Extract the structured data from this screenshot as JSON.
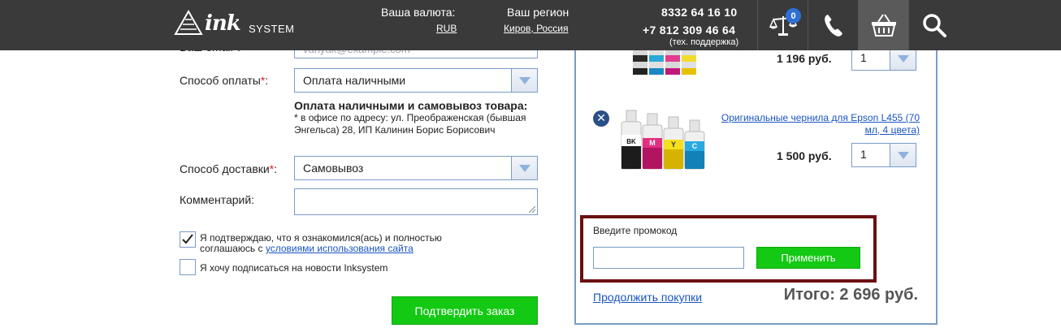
{
  "header": {
    "logo_text_ink": "ink",
    "logo_text_system": "SYSTEM",
    "currency_label": "Ваша валюта:",
    "currency_value": "RUB",
    "region_label": "Ваш регион",
    "region_value": "Киров, Россия",
    "phone_1": "8332 64 16 10",
    "phone_2": "+7 812 309 46 64",
    "phone_note": "(тех. поддержка)",
    "compare_count": "0",
    "icons": [
      "scales-icon",
      "phone-icon",
      "basket-icon",
      "search-icon"
    ]
  },
  "form": {
    "email_label_partial": "Ваш email*:",
    "email_value_partial": "vanyak@example.com",
    "payment_label": "Способ оплаты",
    "payment_value": "Оплата наличными",
    "payment_note_title": "Оплата наличными и самовывоз товара:",
    "payment_note_text": "* в офисе по адресу: ул. Преображенская (бывшая Энгельса) 28, ИП Калинин Борис Борисович",
    "delivery_label": "Способ доставки",
    "delivery_value": "Самовывоз",
    "comment_label": "Комментарий:",
    "required_mark": "*",
    "label_suffix": ":",
    "agree_text": "Я подтверждаю, что я ознакомился(ась) и полностью соглашаюсь с",
    "agree_link": "условиями использования сайта",
    "agree_checked": true,
    "subscribe_text": "Я хочу подписаться на новости Inksystem",
    "subscribe_checked": false,
    "submit_label": "Подтвердить заказ"
  },
  "cart": {
    "items": [
      {
        "price": "1 196 руб.",
        "qty": "1"
      },
      {
        "title": "Оригинальные чернила для Epson L455 (70 мл, 4 цвета)",
        "price": "1 500 руб.",
        "qty": "1",
        "bottle_labels": [
          "BK",
          "M",
          "Y",
          "C"
        ]
      }
    ],
    "remove_symbol": "✕",
    "promo_label": "Введите промокод",
    "promo_value": "",
    "promo_button": "Применить",
    "continue_label": "Продолжить покупки",
    "total": "Итого: 2 696 руб."
  },
  "colors": {
    "header_bg": "#3a3a3a",
    "accent_green": "#13c913",
    "link_blue": "#1a55c0",
    "border_blue": "#7a9cc6",
    "promo_highlight": "#6b0f12",
    "badge_blue": "#2f6fd6"
  }
}
